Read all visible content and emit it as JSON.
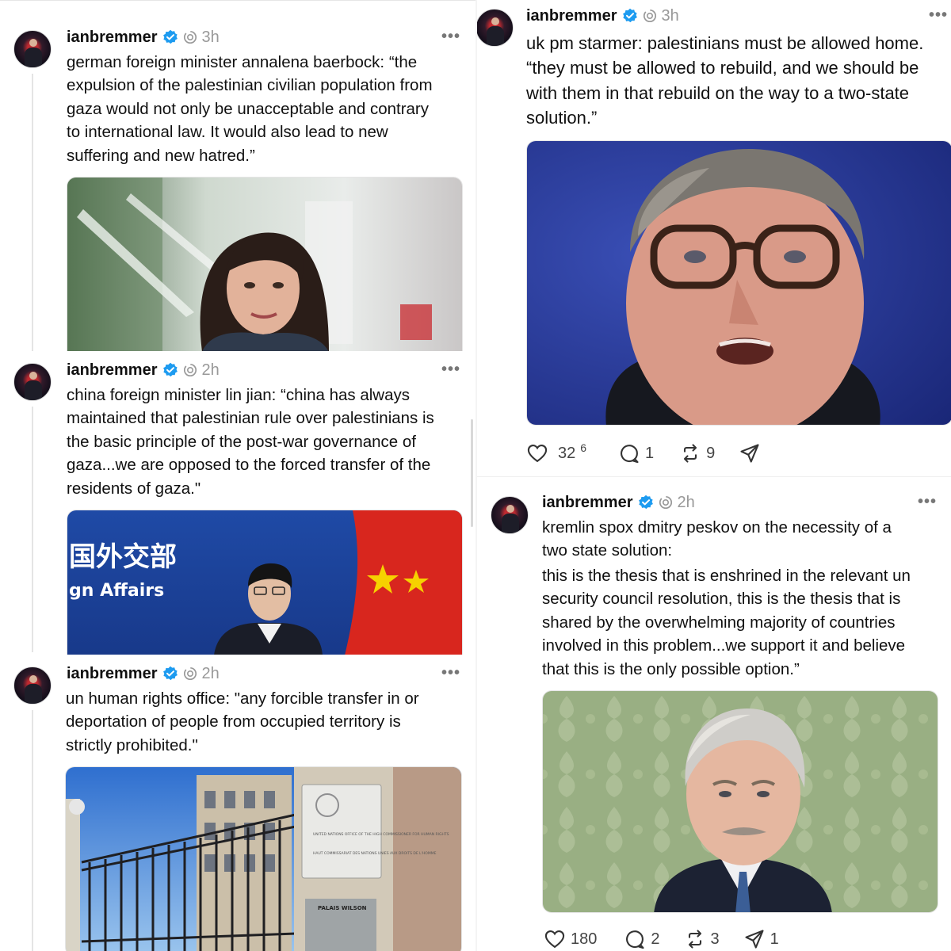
{
  "posts": {
    "baerbock": {
      "username": "ianbremmer",
      "time": "3h",
      "lines": [
        "german foreign minister annalena baerbock: “the",
        "expulsion of the palestinian civilian population from",
        "gaza would not only be unacceptable and contrary",
        "to international law. It would also lead to new",
        "suffering and new hatred.”"
      ]
    },
    "linjian": {
      "username": "ianbremmer",
      "time": "2h",
      "lines": [
        "china foreign minister lin jian: “china has always",
        "maintained that palestinian rule over palestinians is",
        "the basic principle of the post-war governance of",
        "gaza...we are opposed to the forced transfer of the",
        "residents of gaza.\""
      ],
      "image_text": {
        "ministry": "国外交部",
        "ministry_en": "gn Affairs"
      }
    },
    "unhr": {
      "username": "ianbremmer",
      "time": "2h",
      "lines": [
        "un human rights office: \"any forcible transfer in or",
        "deportation of people from occupied territory is",
        "strictly prohibited.\""
      ],
      "image_text": {
        "plaque": "UNITED NATIONS OFFICE OF THE HIGH COMMISSIONER FOR HUMAN RIGHTS",
        "plaque_fr": "HAUT COMMISSARIAT DES NATIONS UNIES AUX DROITS DE L'HOMME",
        "palais": "PALAIS WILSON"
      }
    },
    "starmer": {
      "username": "ianbremmer",
      "time": "3h",
      "lines": [
        "uk pm starmer: palestinians must be allowed home.",
        "“they must be allowed to rebuild, and we should be",
        "with them in that rebuild on the way to a two-state",
        "solution.”"
      ],
      "likes": "32",
      "likes_sup": "6",
      "replies": "1",
      "reposts": "9"
    },
    "peskov": {
      "username": "ianbremmer",
      "time": "2h",
      "lines": [
        "kremlin spox dmitry peskov on the necessity of a",
        "two state solution:"
      ],
      "lines2": [
        "this is the thesis that is enshrined in the relevant un",
        "security council resolution, this is the thesis that is",
        "shared by the overwhelming majority of countries",
        "involved in this problem...we support it and believe",
        "that this is the only possible option.”"
      ],
      "likes": "180",
      "replies": "2",
      "reposts": "3",
      "shares": "1"
    }
  },
  "more_label": "•••",
  "icons": [
    "verified-badge-icon",
    "repost-status-icon",
    "heart-icon",
    "reply-icon",
    "repost-icon",
    "share-icon"
  ],
  "colors": {
    "verified": "#1d9bf0",
    "muted": "#999999",
    "text": "#101010"
  }
}
